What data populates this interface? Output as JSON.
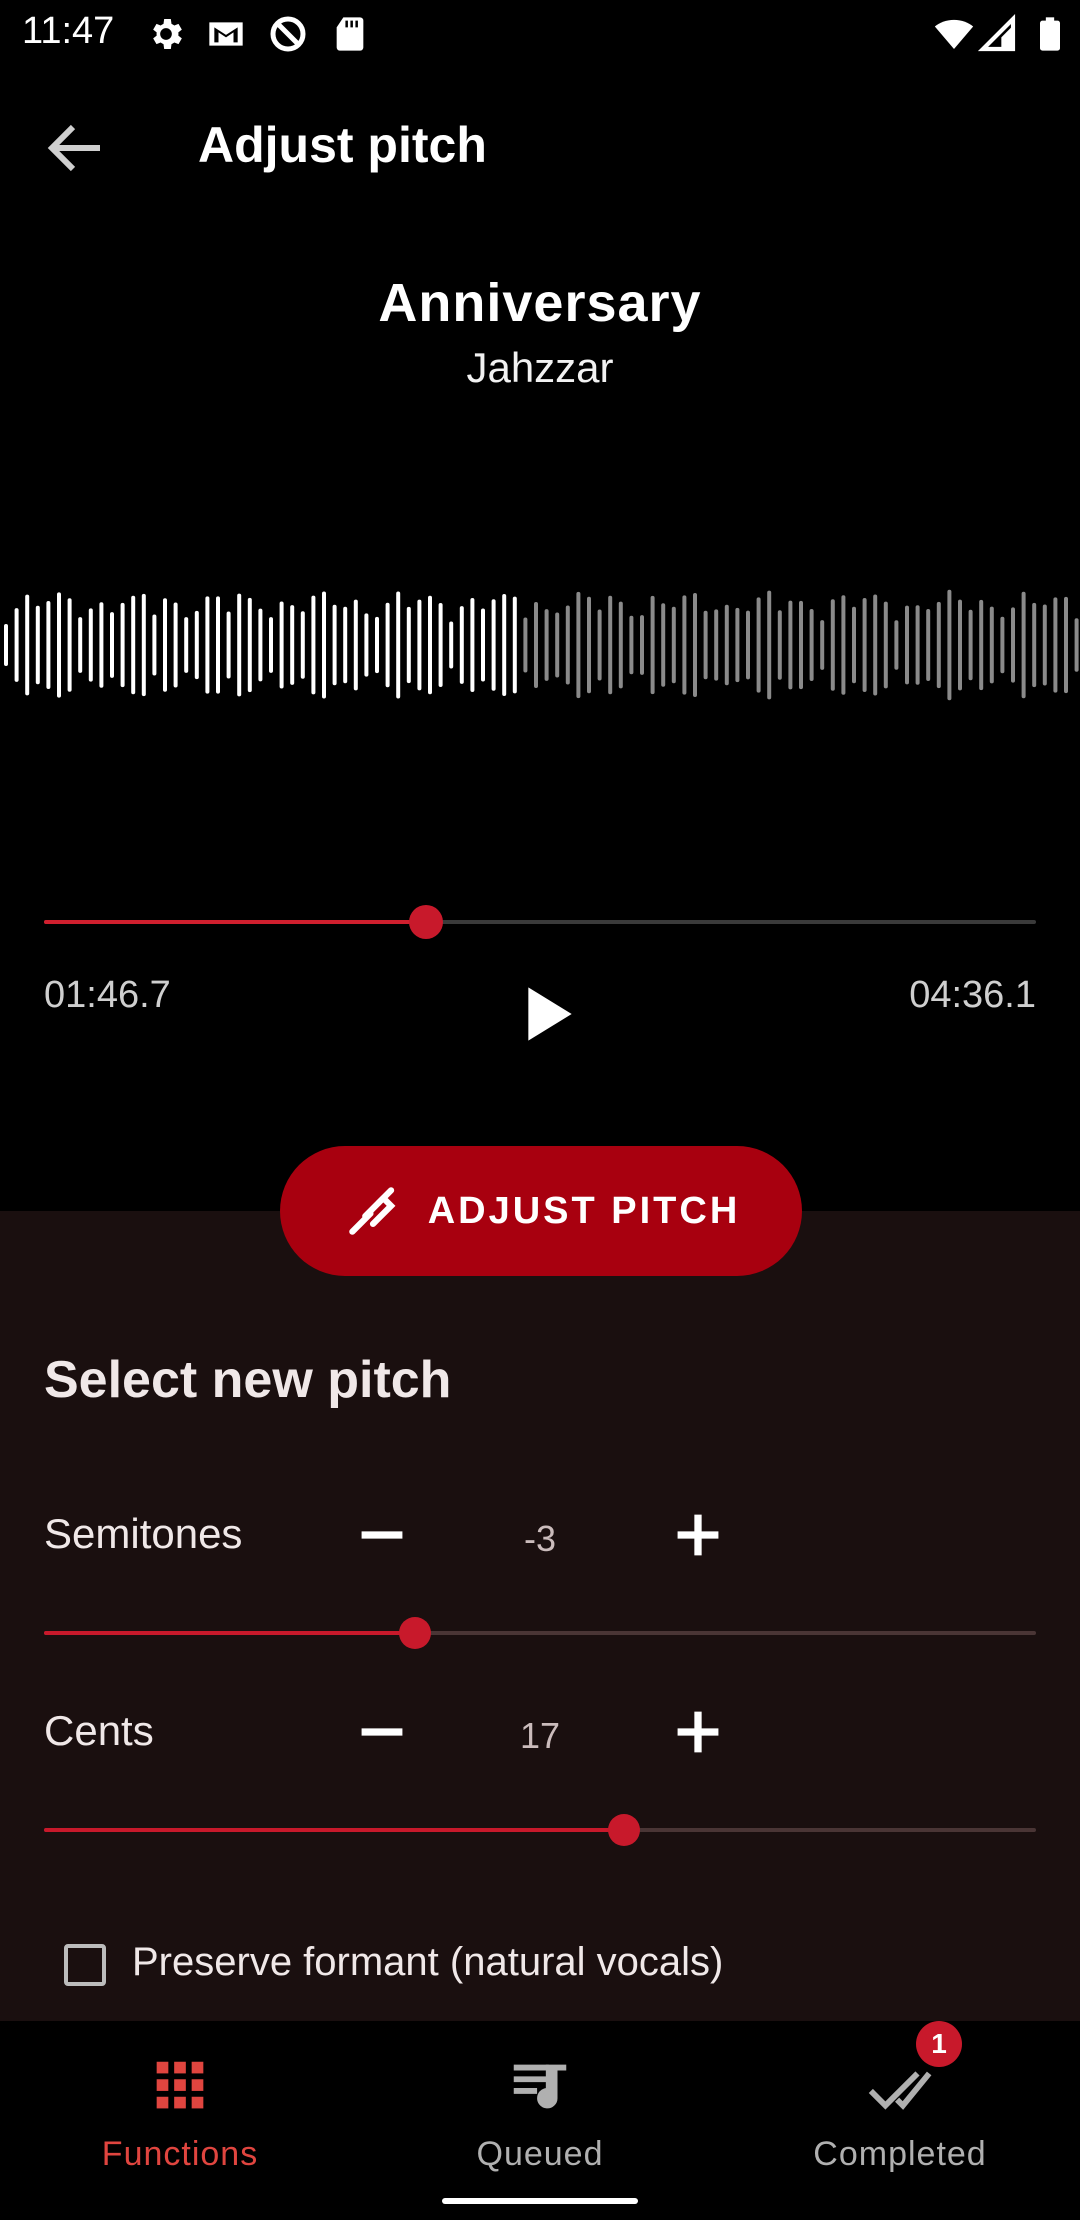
{
  "status_bar": {
    "time": "11:47",
    "icons": [
      "settings-icon",
      "gmail-icon",
      "at-sign-icon",
      "sd-card-icon",
      "wifi-icon",
      "signal-icon",
      "battery-icon"
    ]
  },
  "app_bar": {
    "title": "Adjust pitch",
    "back_icon": "arrow-left-icon"
  },
  "track": {
    "title": "Anniversary",
    "artist": "Jahzzar"
  },
  "player": {
    "current_time": "01:46.7",
    "total_time": "04:36.1",
    "progress": 0.385,
    "play_icon": "play-icon"
  },
  "action": {
    "label": "ADJUST PITCH",
    "icon": "tuning-fork-icon"
  },
  "pitch": {
    "heading": "Select new pitch",
    "semitones": {
      "label": "Semitones",
      "value": "-3",
      "slider_fraction": 0.374
    },
    "cents": {
      "label": "Cents",
      "value": "17",
      "slider_fraction": 0.585
    },
    "preserve_formant": {
      "label": "Preserve formant (natural vocals)",
      "checked": false
    }
  },
  "nav": {
    "items": [
      {
        "label": "Functions",
        "icon": "grid-icon",
        "active": true
      },
      {
        "label": "Queued",
        "icon": "queue-music-icon",
        "active": false
      },
      {
        "label": "Completed",
        "icon": "done-all-icon",
        "active": false,
        "badge": "1"
      }
    ]
  },
  "colors": {
    "accent": "#c8192b",
    "button": "#a8000f",
    "panel": "#1a0f0f",
    "active_nav": "#e0453f"
  }
}
